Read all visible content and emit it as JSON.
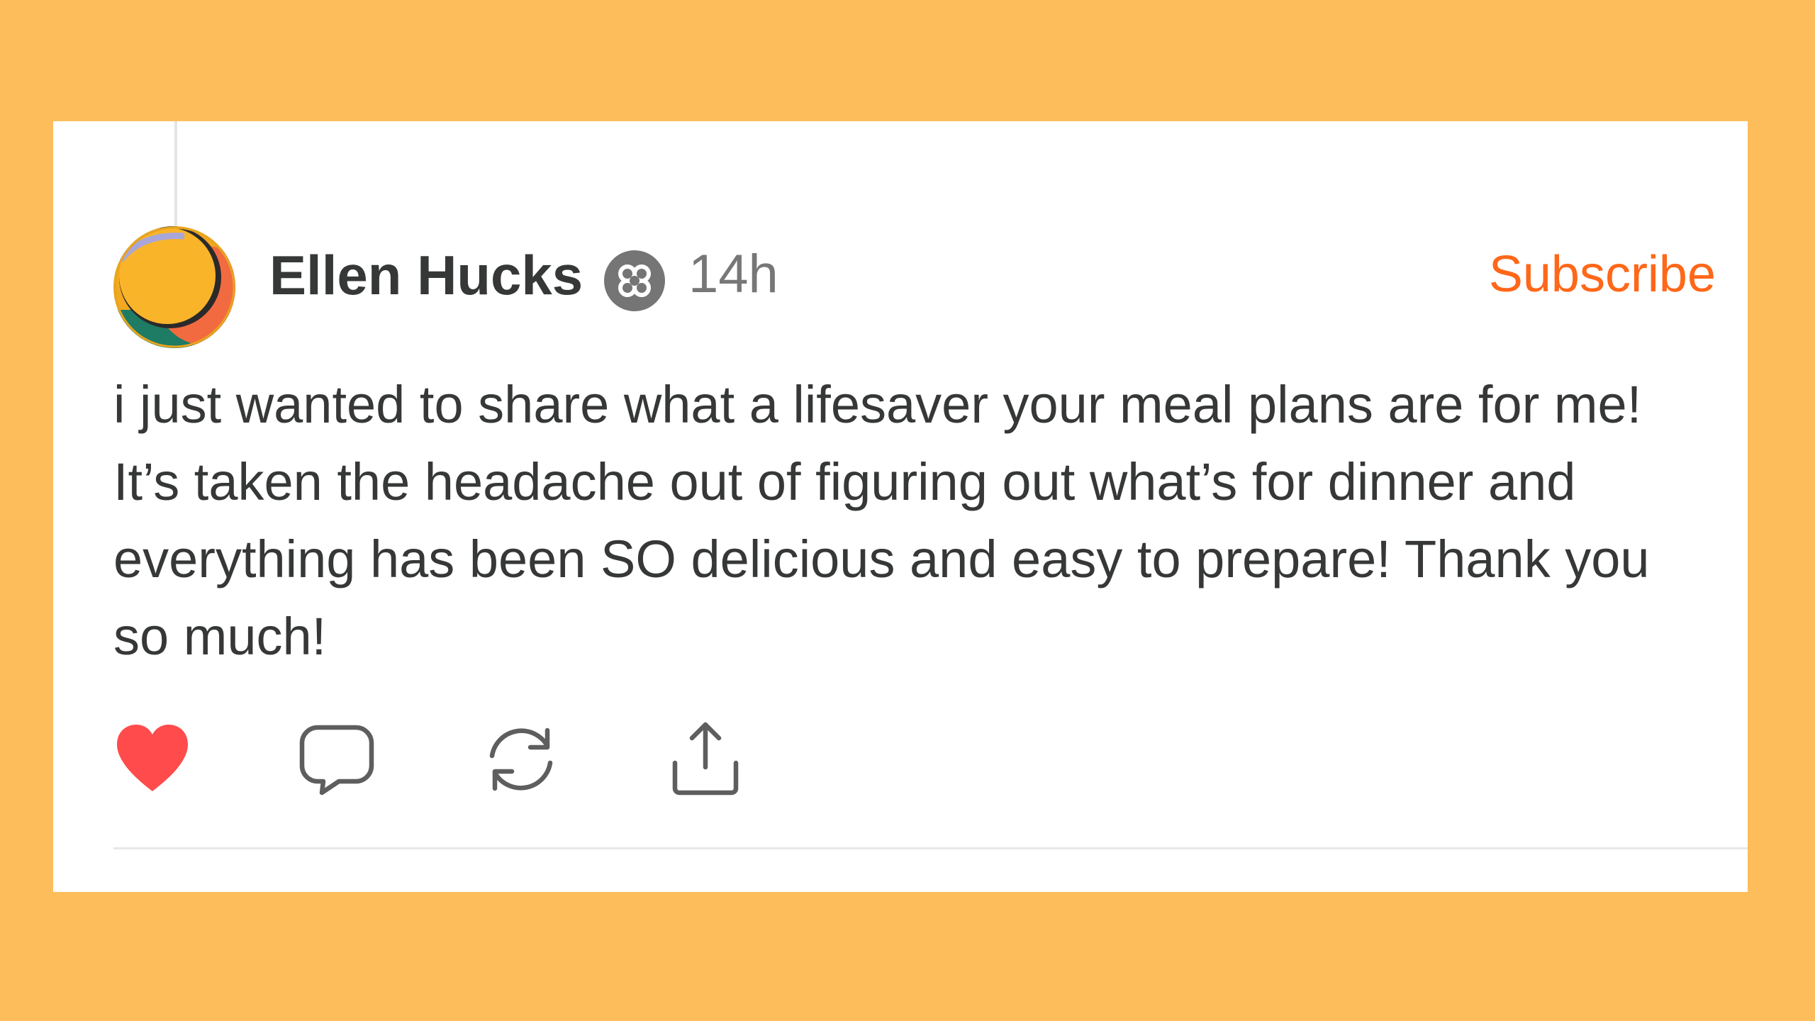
{
  "post": {
    "author": {
      "name": "Ellen Hucks",
      "avatar_icon": "avatar-circle",
      "badge_icon": "flower-badge-icon",
      "time_ago": "14h"
    },
    "subscribe_label": "Subscribe",
    "body": "i just wanted to share what a lifesaver your meal plans are for me! It’s taken the headache out of figuring out what’s for dinner and everything has been SO delicious and easy to prepare! Thank you so much!",
    "actions": {
      "like": {
        "icon": "heart-icon",
        "liked": true
      },
      "comment": {
        "icon": "comment-icon"
      },
      "restack": {
        "icon": "restack-icon"
      },
      "share": {
        "icon": "share-icon"
      }
    }
  },
  "colors": {
    "background": "#FEBD5B",
    "card": "#FFFFFF",
    "accent": "#FF6719",
    "text": "#363737",
    "muted": "#777777",
    "like": "#FF4B4B"
  }
}
